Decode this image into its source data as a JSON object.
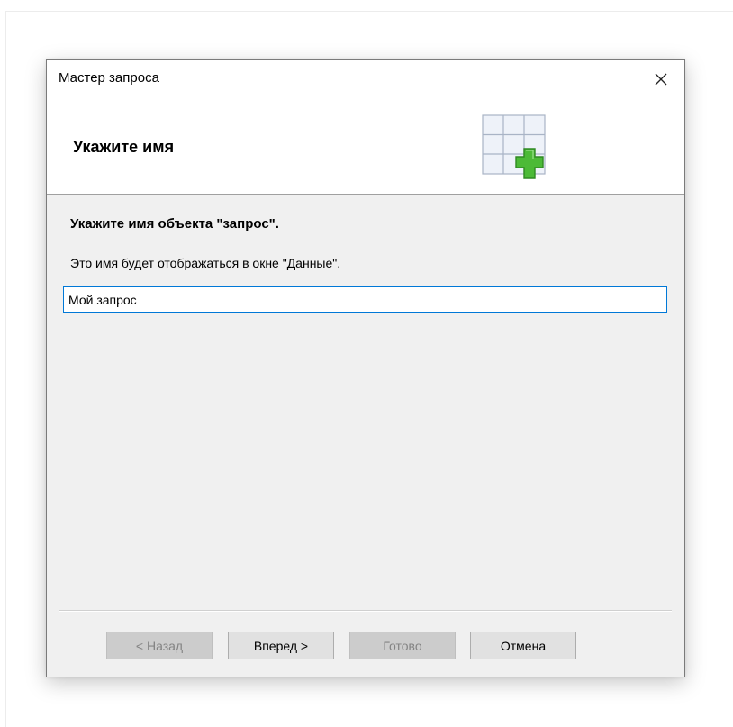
{
  "window": {
    "title": "Мастер запроса",
    "close_icon": "close-icon"
  },
  "header": {
    "heading": "Укажите имя",
    "icon": "table-add-icon",
    "icon_colors": {
      "grid_fill": "#eef2f9",
      "grid_line": "#a9b4c6",
      "plus_fill": "#4cba37",
      "plus_outline": "#2f8a22"
    }
  },
  "body": {
    "instruction": "Укажите имя объекта \"запрос\".",
    "hint": "Это имя будет отображаться в окне \"Данные\".",
    "name_input": {
      "value": "Мой запрос",
      "focus_color": "#0078d7"
    }
  },
  "footer": {
    "back_label": "< Назад",
    "next_label": "Вперед >",
    "finish_label": "Готово",
    "cancel_label": "Отмена",
    "back_enabled": false,
    "next_enabled": true,
    "finish_enabled": false,
    "cancel_enabled": true
  }
}
